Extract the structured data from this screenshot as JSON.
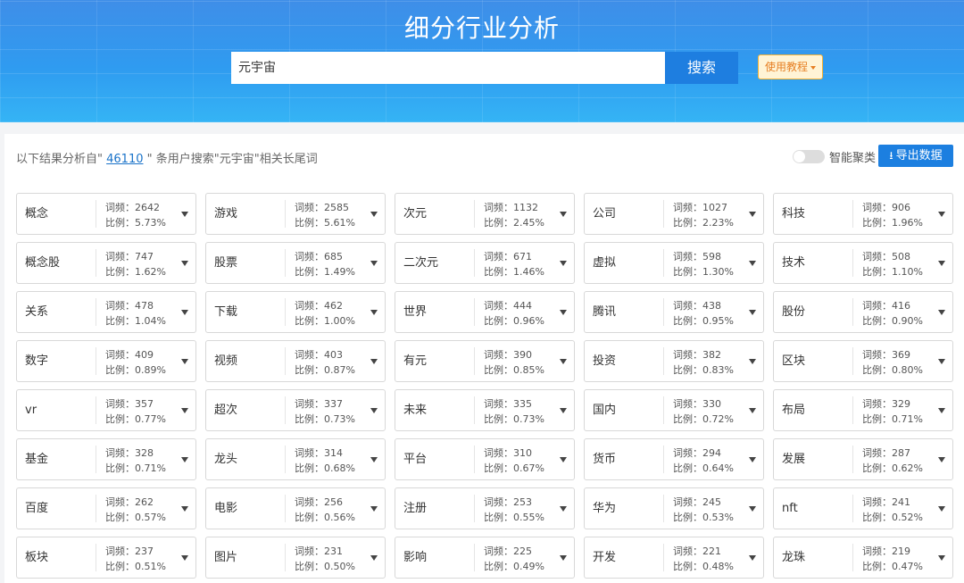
{
  "header": {
    "title": "细分行业分析",
    "search_value": "元宇宙",
    "search_button": "搜索",
    "tutorial_button": "使用教程"
  },
  "toolbar": {
    "summary_prefix": "以下结果分析自\" ",
    "summary_count": "46110",
    "summary_suffix": " \" 条用户搜索\"元宇宙\"相关长尾词",
    "smart_cluster_label": "智能聚类",
    "export_button": "导出数据"
  },
  "labels": {
    "freq": "词频：",
    "ratio": "比例："
  },
  "items": [
    {
      "word": "概念",
      "freq": "2642",
      "ratio": "5.73%"
    },
    {
      "word": "游戏",
      "freq": "2585",
      "ratio": "5.61%"
    },
    {
      "word": "次元",
      "freq": "1132",
      "ratio": "2.45%"
    },
    {
      "word": "公司",
      "freq": "1027",
      "ratio": "2.23%"
    },
    {
      "word": "科技",
      "freq": "906",
      "ratio": "1.96%"
    },
    {
      "word": "概念股",
      "freq": "747",
      "ratio": "1.62%"
    },
    {
      "word": "股票",
      "freq": "685",
      "ratio": "1.49%"
    },
    {
      "word": "二次元",
      "freq": "671",
      "ratio": "1.46%"
    },
    {
      "word": "虚拟",
      "freq": "598",
      "ratio": "1.30%"
    },
    {
      "word": "技术",
      "freq": "508",
      "ratio": "1.10%"
    },
    {
      "word": "关系",
      "freq": "478",
      "ratio": "1.04%"
    },
    {
      "word": "下载",
      "freq": "462",
      "ratio": "1.00%"
    },
    {
      "word": "世界",
      "freq": "444",
      "ratio": "0.96%"
    },
    {
      "word": "腾讯",
      "freq": "438",
      "ratio": "0.95%"
    },
    {
      "word": "股份",
      "freq": "416",
      "ratio": "0.90%"
    },
    {
      "word": "数字",
      "freq": "409",
      "ratio": "0.89%"
    },
    {
      "word": "视频",
      "freq": "403",
      "ratio": "0.87%"
    },
    {
      "word": "有元",
      "freq": "390",
      "ratio": "0.85%"
    },
    {
      "word": "投资",
      "freq": "382",
      "ratio": "0.83%"
    },
    {
      "word": "区块",
      "freq": "369",
      "ratio": "0.80%"
    },
    {
      "word": "vr",
      "freq": "357",
      "ratio": "0.77%"
    },
    {
      "word": "超次",
      "freq": "337",
      "ratio": "0.73%"
    },
    {
      "word": "未来",
      "freq": "335",
      "ratio": "0.73%"
    },
    {
      "word": "国内",
      "freq": "330",
      "ratio": "0.72%"
    },
    {
      "word": "布局",
      "freq": "329",
      "ratio": "0.71%"
    },
    {
      "word": "基金",
      "freq": "328",
      "ratio": "0.71%"
    },
    {
      "word": "龙头",
      "freq": "314",
      "ratio": "0.68%"
    },
    {
      "word": "平台",
      "freq": "310",
      "ratio": "0.67%"
    },
    {
      "word": "货币",
      "freq": "294",
      "ratio": "0.64%"
    },
    {
      "word": "发展",
      "freq": "287",
      "ratio": "0.62%"
    },
    {
      "word": "百度",
      "freq": "262",
      "ratio": "0.57%"
    },
    {
      "word": "电影",
      "freq": "256",
      "ratio": "0.56%"
    },
    {
      "word": "注册",
      "freq": "253",
      "ratio": "0.55%"
    },
    {
      "word": "华为",
      "freq": "245",
      "ratio": "0.53%"
    },
    {
      "word": "nft",
      "freq": "241",
      "ratio": "0.52%"
    },
    {
      "word": "板块",
      "freq": "237",
      "ratio": "0.51%"
    },
    {
      "word": "图片",
      "freq": "231",
      "ratio": "0.50%"
    },
    {
      "word": "影响",
      "freq": "225",
      "ratio": "0.49%"
    },
    {
      "word": "开发",
      "freq": "221",
      "ratio": "0.48%"
    },
    {
      "word": "龙珠",
      "freq": "219",
      "ratio": "0.47%"
    }
  ]
}
